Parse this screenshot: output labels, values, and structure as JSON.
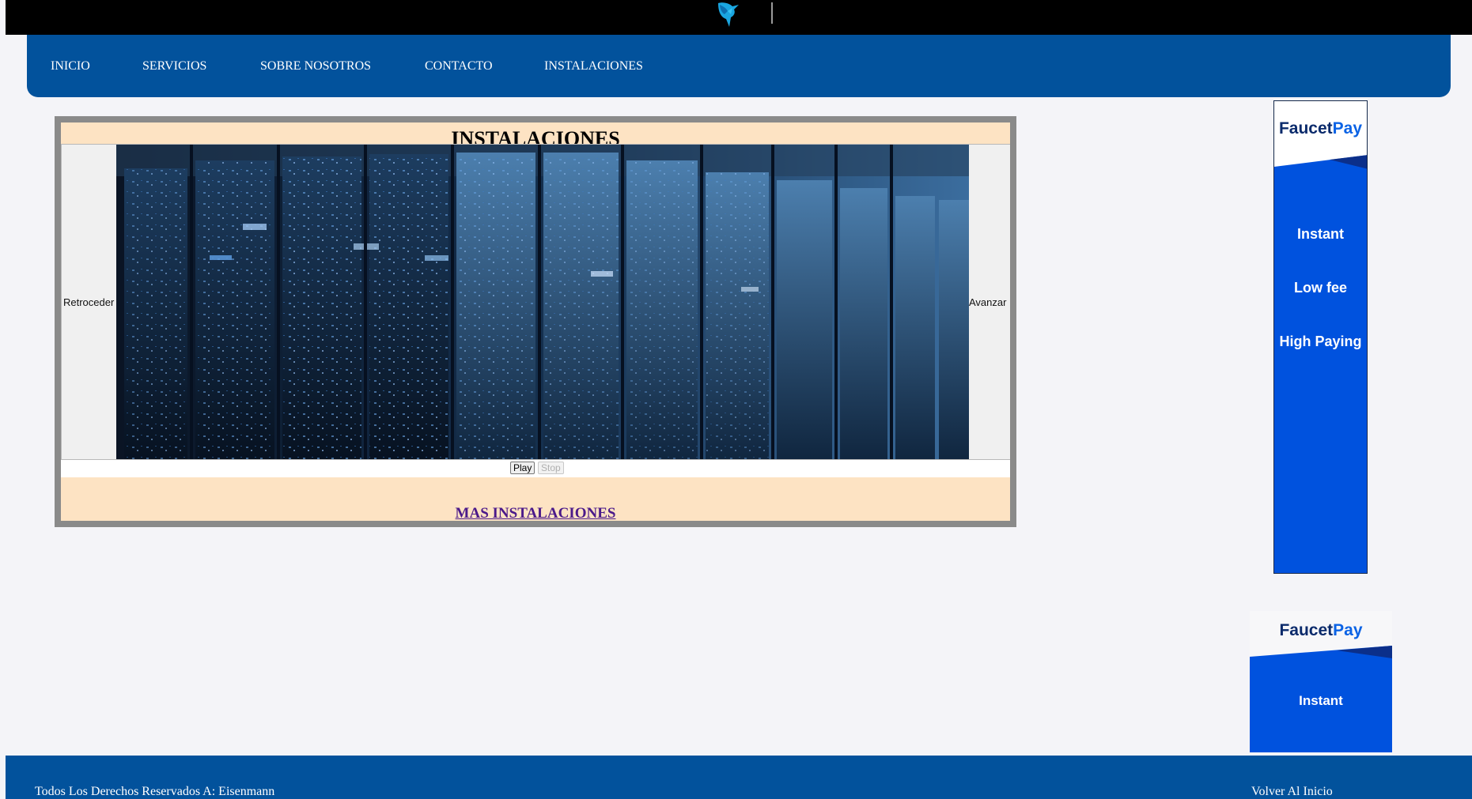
{
  "header": {
    "logo_icon": "bird-logo-icon"
  },
  "nav": {
    "items": [
      {
        "label": "INICIO"
      },
      {
        "label": "SERVICIOS"
      },
      {
        "label": "SOBRE NOSOTROS"
      },
      {
        "label": "CONTACTO"
      },
      {
        "label": "INSTALACIONES"
      }
    ]
  },
  "main": {
    "title": "INSTALACIONES",
    "slider": {
      "prev_label": "Retroceder",
      "next_label": "Avanzar",
      "image_subject": "server racks in data center"
    },
    "controls": {
      "play_label": "Play",
      "stop_label": "Stop"
    },
    "more_link": "MAS INSTALACIONES"
  },
  "ads": [
    {
      "brand_a": "Faucet",
      "brand_b": "Pay",
      "lines": [
        "Instant",
        "Low fee",
        "High Paying"
      ]
    },
    {
      "brand_a": "Faucet",
      "brand_b": "Pay",
      "lines": [
        "Instant"
      ]
    }
  ],
  "footer": {
    "rights": "Todos Los Derechos Reservados A: Eisenmann",
    "back_home": "Volver Al Inicio"
  },
  "colors": {
    "nav_bg": "#02529c",
    "frame_bg": "#fde3c3",
    "ad_blue": "#0052de",
    "link_purple": "#4b1a8a"
  }
}
